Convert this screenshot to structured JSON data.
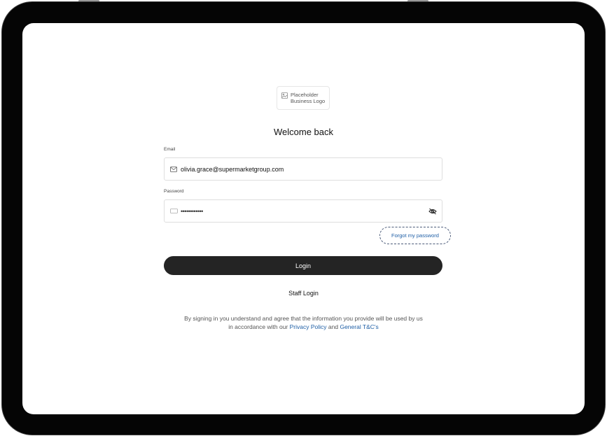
{
  "logo": {
    "text": "Placeholder\nBusiness Logo",
    "icon": "image-placeholder-icon"
  },
  "heading": "Welcome back",
  "email": {
    "label": "Email",
    "value": "olivia.grace@supermarketgroup.com",
    "icon": "mail-icon"
  },
  "password": {
    "label": "Password",
    "value": "••••••••••••",
    "icon": "keyboard-icon",
    "toggle_icon": "eye-off-icon"
  },
  "forgot_link": "Forgot my password",
  "login_button": "Login",
  "staff_login": "Staff Login",
  "terms": {
    "line1": "By signing in you understand and agree that the information you provide will be used by us",
    "line2_prefix": "in accordance with our",
    "privacy_link": "Privacy Policy",
    "conjunction": "and",
    "tc_link": "General T&C's"
  },
  "colors": {
    "primary_button": "#242424",
    "link": "#1f5fa6",
    "bezel": "#050505"
  }
}
